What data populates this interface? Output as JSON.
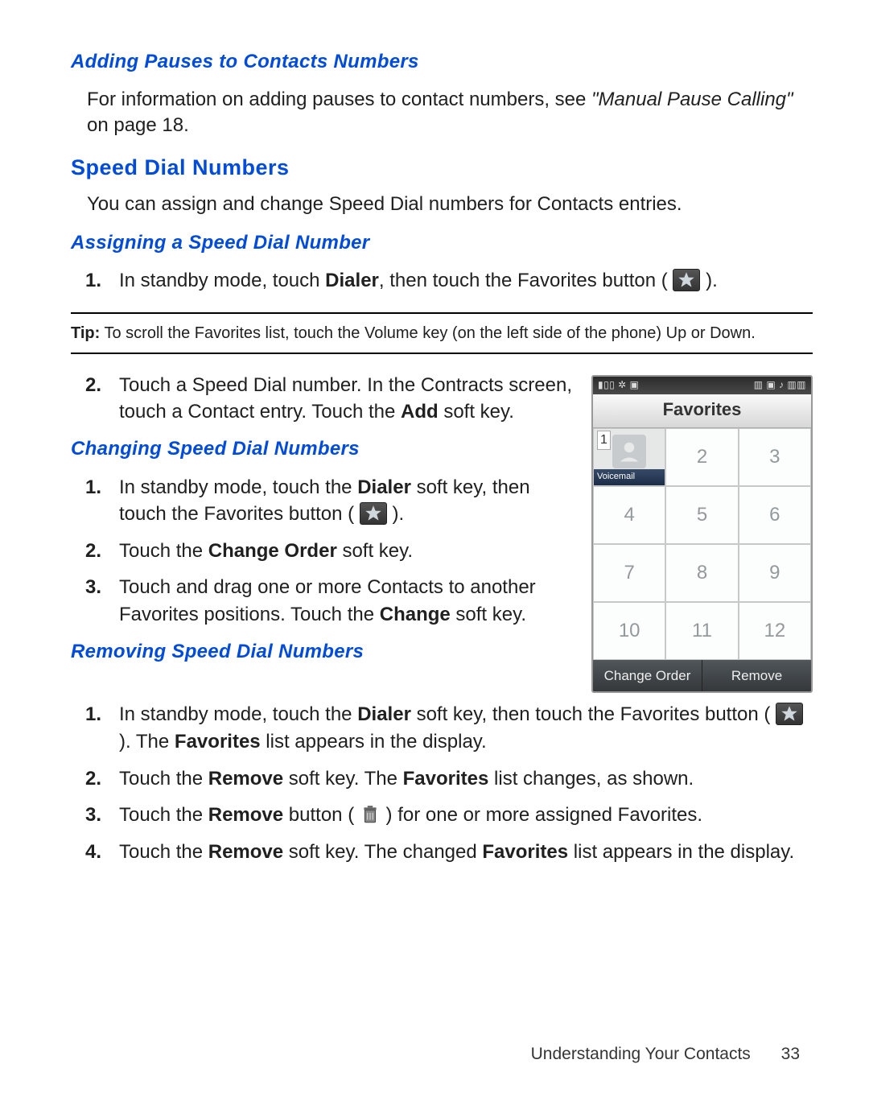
{
  "headings": {
    "adding_pauses": "Adding Pauses to Contacts Numbers",
    "speed_dial": "Speed Dial Numbers",
    "assigning": "Assigning a Speed Dial Number",
    "changing": "Changing Speed Dial Numbers",
    "removing": "Removing Speed Dial Numbers"
  },
  "paragraphs": {
    "adding_pauses_pre": "For information on adding pauses to contact numbers, see ",
    "adding_pauses_ref": "\"Manual Pause Calling\"",
    "adding_pauses_post": " on page 18.",
    "speed_dial": "You can assign and change Speed Dial numbers for Contacts entries."
  },
  "tip": {
    "label": "Tip:",
    "text": " To scroll the Favorites list, touch the Volume key (on the left side of the phone) Up or Down."
  },
  "assigning_steps": {
    "s1_pre": "In standby mode, touch ",
    "s1_bold": "Dialer",
    "s1_mid": ", then touch the Favorites button ( ",
    "s1_post": " ).",
    "s2_pre": "Touch a Speed Dial number. In the Contracts screen, touch a Contact entry. Touch the ",
    "s2_bold": "Add",
    "s2_post": " soft key."
  },
  "changing_steps": {
    "s1_pre": "In standby mode, touch the ",
    "s1_bold": "Dialer",
    "s1_mid": " soft key, then touch the Favorites button ( ",
    "s1_post": " ).",
    "s2_pre": "Touch the ",
    "s2_bold": "Change Order",
    "s2_post": " soft key.",
    "s3_pre": "Touch and drag one or more Contacts to another Favorites positions. Touch the ",
    "s3_bold": "Change",
    "s3_post": " soft key."
  },
  "removing_steps": {
    "s1_pre": "In standby mode, touch the ",
    "s1_bold1": "Dialer",
    "s1_mid1": " soft key, then touch the Favorites button ( ",
    "s1_mid2": " ). The ",
    "s1_bold2": "Favorites",
    "s1_post": " list appears in the display.",
    "s2_pre": "Touch the ",
    "s2_bold1": "Remove",
    "s2_mid": " soft key. The ",
    "s2_bold2": "Favorites",
    "s2_post": " list changes, as shown.",
    "s3_pre": "Touch the ",
    "s3_bold": "Remove",
    "s3_mid": " button ( ",
    "s3_post": " ) for one or more assigned Favorites.",
    "s4_pre": "Touch the ",
    "s4_bold1": "Remove",
    "s4_mid": " soft key. The changed ",
    "s4_bold2": "Favorites",
    "s4_post": " list appears in the display."
  },
  "screenshot": {
    "status_left": "▮▯▯  ✲ ▣",
    "status_right": "▥ ▣ ♪ ▥▥",
    "title": "Favorites",
    "voicemail_label": "Voicemail",
    "cells": [
      "1",
      "2",
      "3",
      "4",
      "5",
      "6",
      "7",
      "8",
      "9",
      "10",
      "11",
      "12"
    ],
    "actions": {
      "left": "Change Order",
      "right": "Remove"
    }
  },
  "footer": {
    "section": "Understanding Your Contacts",
    "page": "33"
  },
  "nums": {
    "n1": "1.",
    "n2": "2.",
    "n3": "3.",
    "n4": "4."
  }
}
